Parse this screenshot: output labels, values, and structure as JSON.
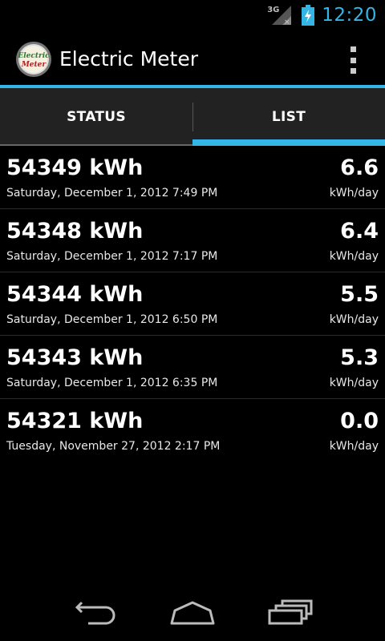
{
  "status_bar": {
    "network_label": "3G",
    "time": "12:20",
    "accent_color": "#33b5e5"
  },
  "action_bar": {
    "logo_text_line1": "Electric",
    "logo_text_line2": "Meter",
    "title": "Electric Meter",
    "overflow_icon": "overflow-menu-icon"
  },
  "tabs": [
    {
      "label": "STATUS",
      "selected": false
    },
    {
      "label": "LIST",
      "selected": true
    }
  ],
  "readings": [
    {
      "kwh": "54349 kWh",
      "date": "Saturday, December 1, 2012 7:49 PM",
      "rate": "6.6",
      "unit": "kWh/day"
    },
    {
      "kwh": "54348 kWh",
      "date": "Saturday, December 1, 2012 7:17 PM",
      "rate": "6.4",
      "unit": "kWh/day"
    },
    {
      "kwh": "54344 kWh",
      "date": "Saturday, December 1, 2012 6:50 PM",
      "rate": "5.5",
      "unit": "kWh/day"
    },
    {
      "kwh": "54343 kWh",
      "date": "Saturday, December 1, 2012 6:35 PM",
      "rate": "5.3",
      "unit": "kWh/day"
    },
    {
      "kwh": "54321 kWh",
      "date": "Tuesday, November 27, 2012 2:17 PM",
      "rate": "0.0",
      "unit": "kWh/day"
    }
  ],
  "nav_bar": {
    "back_icon": "back-icon",
    "home_icon": "home-icon",
    "recent_icon": "recent-apps-icon"
  }
}
